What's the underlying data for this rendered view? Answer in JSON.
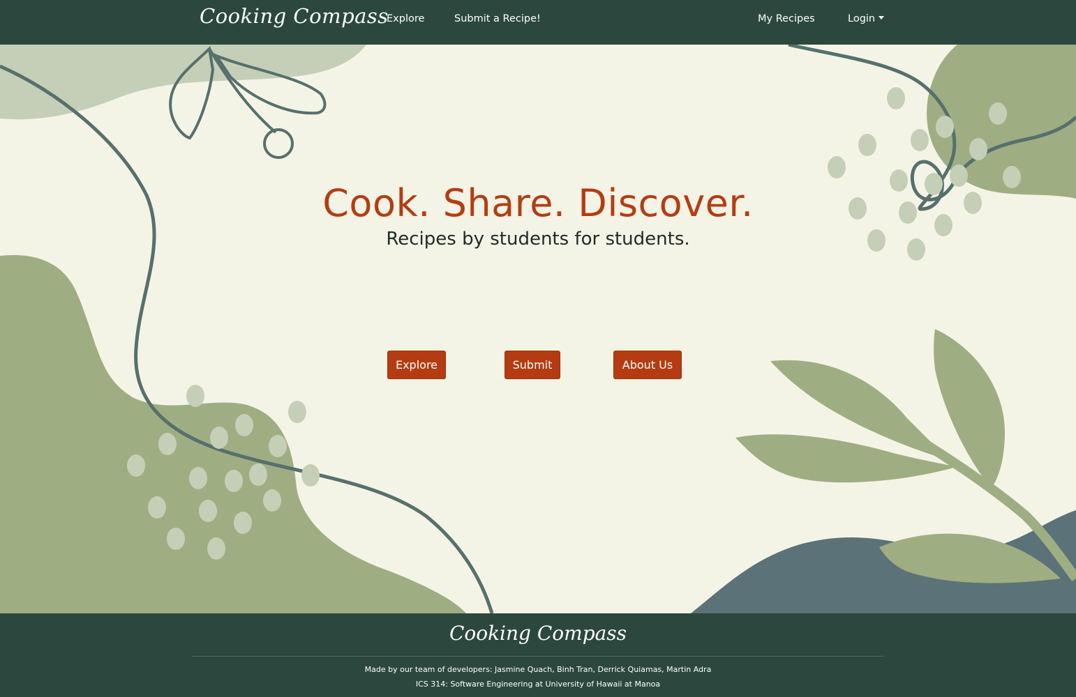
{
  "navbar": {
    "brand": "Cooking Compass",
    "links": {
      "explore": "Explore",
      "submit": "Submit a Recipe!",
      "my_recipes": "My Recipes",
      "login": "Login"
    }
  },
  "hero": {
    "headline": "Cook. Share. Discover.",
    "subheadline": "Recipes by students for students.",
    "buttons": {
      "explore": "Explore",
      "submit": "Submit",
      "about": "About Us"
    }
  },
  "footer": {
    "brand": "Cooking Compass",
    "credits": "Made by our team of developers: Jasmine Quach, Binh Tran, Derrick Quiamas, Martin Adra",
    "course": "ICS 314: Software Engineering at University of Hawaii at Manoa"
  },
  "colors": {
    "nav_bg": "#2c483e",
    "hero_bg": "#f4f4e6",
    "accent": "#b53c12",
    "sage": "#9eae82",
    "sage_light": "#c5cfb7",
    "slate": "#5a7278",
    "line": "#56706d"
  }
}
